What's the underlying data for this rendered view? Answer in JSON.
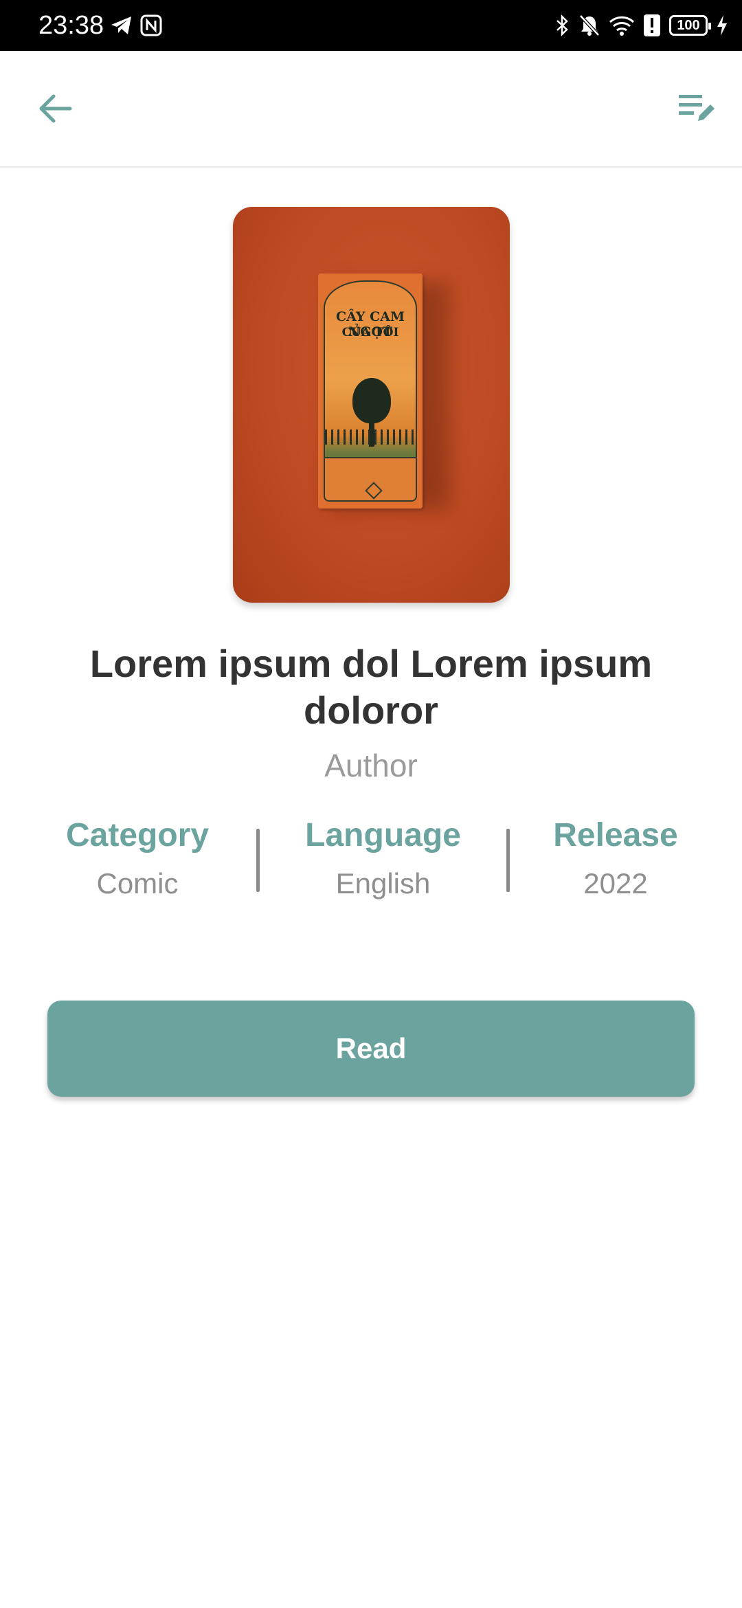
{
  "status_bar": {
    "time": "23:38",
    "battery": "100",
    "icons": [
      "telegram-icon",
      "nfc-icon",
      "bluetooth-icon",
      "bell-off-icon",
      "wifi-icon",
      "alert-icon",
      "battery-icon",
      "charging-icon"
    ]
  },
  "app_bar": {
    "back_icon": "arrow-left-icon",
    "action_icon": "edit-list-icon"
  },
  "book": {
    "cover_text_line1": "CÂY CAM NGỌT",
    "cover_text_line2": "CỦA TÔI",
    "title": "Lorem ipsum dol Lorem ipsum doloror",
    "author": "Author",
    "meta": {
      "category_label": "Category",
      "category_value": "Comic",
      "language_label": "Language",
      "language_value": "English",
      "release_label": "Release",
      "release_value": "2022"
    }
  },
  "actions": {
    "read_label": "Read"
  },
  "colors": {
    "accent": "#6ba39e",
    "title": "#333333",
    "muted": "#9a9a9a",
    "cover_bg": "#bd4a22"
  }
}
